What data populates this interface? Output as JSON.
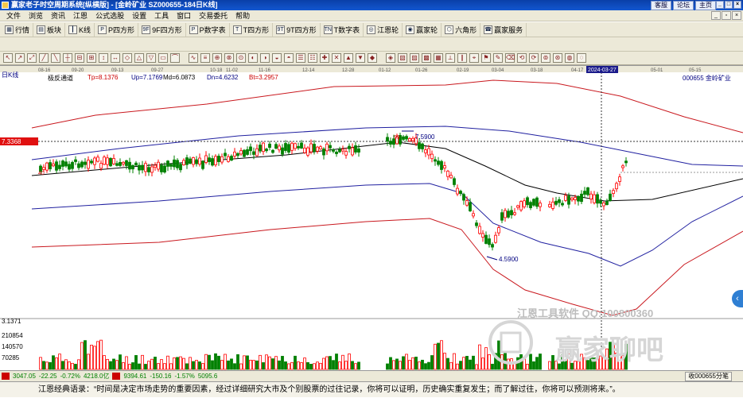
{
  "window": {
    "title": "赢家老子时空周期系统[纵横版] - [金岭矿业  SZ000655-184日K线]",
    "links": [
      "客服",
      "论坛",
      "主页"
    ]
  },
  "menu": [
    "文件",
    "浏览",
    "资讯",
    "江恩",
    "公式选股",
    "设置",
    "工具",
    "窗口",
    "交易委托",
    "帮助"
  ],
  "toolbar": [
    {
      "label": "行情",
      "icon": "grid-icon"
    },
    {
      "label": "板块",
      "icon": "blocks-icon"
    },
    {
      "label": "K线",
      "icon": "candle-icon"
    },
    {
      "label": "P四方形",
      "icon": "P"
    },
    {
      "label": "9F四方形",
      "icon": "9F"
    },
    {
      "label": "P数字表",
      "icon": "P"
    },
    {
      "label": "T四方形",
      "icon": "T"
    },
    {
      "label": "9T四方形",
      "icon": "9T"
    },
    {
      "label": "T数字表",
      "icon": "TN"
    },
    {
      "label": "江恩轮",
      "icon": "wheel-icon"
    },
    {
      "label": "赢家轮",
      "icon": "wheel-icon"
    },
    {
      "label": "六角形",
      "icon": "hex-icon"
    },
    {
      "label": "赢家服务",
      "icon": "service-icon"
    }
  ],
  "chart": {
    "period": "日K线",
    "code_name": "000655 金岭矿业",
    "indicator": {
      "name": "极反通道",
      "tp": "Tp=8.1376",
      "up": "Up=7.1769",
      "md": "Md=6.0873",
      "dn": "Dn=4.6232",
      "bt": "Bt=3.2957"
    },
    "crosshair_price": "7.3368",
    "crosshair_date": "2024-03-27",
    "high_label": "7.5900",
    "low_label": "4.5900",
    "left_mark": "40",
    "mid_mark": "99",
    "date_axis": [
      "08-16",
      "09-20",
      "09-13",
      "09-27",
      "10-18",
      "11-02",
      "11-16",
      "12-14",
      "12-28",
      "01-12",
      "01-26",
      "02-19",
      "03-04",
      "03-18",
      "04-17",
      "05-01",
      "05-15"
    ],
    "volume_axis": [
      "3.1371",
      "210854",
      "140570",
      "70285"
    ],
    "watermark_text": "江恩工具软件 QQ:100800360",
    "watermark_logo": "赢家聊吧"
  },
  "colors": {
    "up": "#ff0000",
    "down": "#008000",
    "outer_channel": "#c9181e",
    "mid_channel": "#2020a0",
    "ma": "#000000"
  },
  "status": {
    "sh": "3047.05",
    "sh_chg": "-22.25",
    "sh_pct": "-0.72%",
    "sh_amt": "4218.0亿",
    "sz": "9394.61",
    "sz_chg": "-150.16",
    "sz_pct": "-1.57%",
    "sz_amt": "5095.6",
    "right": "收000655分笔"
  },
  "quote": "江恩经典语录：“时间是决定市场走势的重要因素，经过详细研究大市及个别股票的过往记录，你将可以证明，历史确实重复发生；而了解过往，你将可以预测将来。”。"
}
